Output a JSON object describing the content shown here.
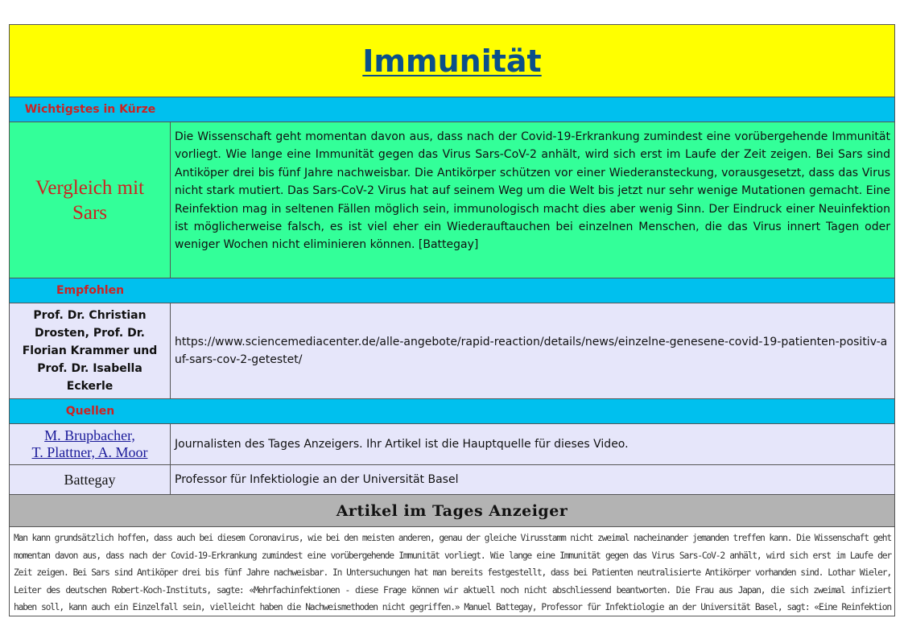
{
  "title": "Immunität",
  "sections": {
    "summary_label": "Wichtigstes in Kürze",
    "recommended_label": "Empfohlen",
    "sources_label": "Quellen"
  },
  "summary": {
    "topic": "Vergleich mit Sars",
    "text": "Die Wissenschaft geht momentan davon aus, dass nach der Covid-19-Erkrankung zumindest eine vorübergehende Immunität vorliegt. Wie lange eine Immunität gegen das Virus Sars-CoV-2 anhält, wird sich erst im Laufe der Zeit zeigen. Bei Sars sind Antiköper drei bis fünf Jahre nachweisbar. Die Antikörper schützen vor einer Wiederansteckung, vorausgesetzt, dass das Virus nicht stark mutiert. Das Sars-CoV-2 Virus hat auf seinem Weg um die Welt bis jetzt nur sehr wenige Mutationen gemacht. Eine Reinfektion mag in seltenen Fällen möglich sein, immunologisch macht dies aber wenig Sinn. Der Eindruck einer Neuinfektion ist möglicherweise falsch, es ist viel eher ein Wiederauftauchen bei einzelnen Menschen, die das Virus innert Tagen oder weniger Wochen nicht eliminieren können. [Battegay]"
  },
  "recommended": {
    "authors": "Prof. Dr. Christian Drosten, Prof. Dr. Florian Krammer und Prof. Dr. Isabella Eckerle",
    "url": "https://www.sciencemediacenter.de/alle-angebote/rapid-reaction/details/news/einzelne-genesene-covid-19-patienten-positiv-auf-sars-cov-2-getestet/"
  },
  "sources": [
    {
      "name_line1": "M. Brupbacher,",
      "name_line2": "T. Plattner, A. Moor",
      "description": "Journalisten des Tages Anzeigers. Ihr Artikel ist die Hauptquelle für dieses Video."
    },
    {
      "name": "Battegay",
      "description": "Professor für Infektiologie an der Universität Basel"
    }
  ],
  "article": {
    "heading": "Artikel im Tages Anzeiger",
    "text": "Man kann grundsätzlich hoffen, dass auch bei diesem Coronavirus, wie bei den meisten anderen, genau der gleiche Virusstamm nicht zweimal nacheinander jemanden treffen kann. Die Wissenschaft geht momentan davon aus, dass nach der Covid-19-Erkrankung zumindest eine vorübergehende Immunität vorliegt. Wie lange eine Immunität gegen das Virus Sars-CoV-2 anhält, wird sich erst im Laufe der Zeit zeigen. Bei Sars sind Antiköper drei bis fünf Jahre nachweisbar. In Untersuchungen hat man bereits festgestellt, dass bei Patienten neutralisierte Antikörper vorhanden sind. Lothar Wieler, Leiter des deutschen Robert-Koch-Instituts, sagte: «Mehrfachinfektionen - diese Frage können wir aktuell noch nicht abschliessend beantworten. Die Frau aus Japan, die sich zweimal infiziert haben soll, kann auch ein Einzelfall sein, vielleicht haben die Nachweismethoden nicht gegriffen.» Manuel Battegay, Professor für Infektiologie an der Universität Basel, sagt: «Eine Reinfektion mag in ja"
  },
  "colors": {
    "title_bg": "#ffff00",
    "title_text": "#0b4f8a",
    "section_bar": "#00c0ee",
    "section_label": "#cc2222",
    "summary_bg": "#33ff99",
    "table_bg": "#e6e6fa",
    "article_head_bg": "#b3b3b3"
  }
}
